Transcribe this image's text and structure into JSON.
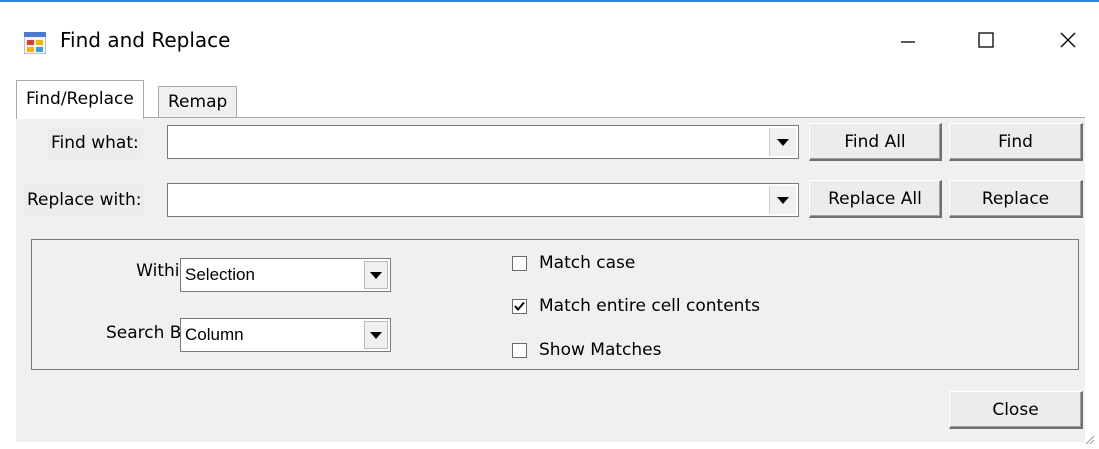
{
  "window": {
    "title": "Find and Replace",
    "icon": "form-app-icon",
    "controls": [
      "minimize-icon",
      "maximize-icon",
      "close-icon"
    ]
  },
  "tabs": [
    {
      "label": "Find/Replace",
      "active": true
    },
    {
      "label": "Remap",
      "active": false
    }
  ],
  "find": {
    "label": "Find what:",
    "value": "",
    "find_all_label": "Find All",
    "find_label": "Find"
  },
  "replace": {
    "label": "Replace with:",
    "value": "",
    "replace_all_label": "Replace All",
    "replace_label": "Replace"
  },
  "options": {
    "within_label": "Within:",
    "within_value": "Selection",
    "search_by_label": "Search By:",
    "search_by_value": "Column",
    "checkboxes": [
      {
        "label": "Match case",
        "checked": false
      },
      {
        "label": "Match entire cell contents",
        "checked": true
      },
      {
        "label": "Show Matches",
        "checked": false
      }
    ]
  },
  "footer": {
    "close_label": "Close"
  },
  "colors": {
    "title_accent": "#2e87d8",
    "panel_bg": "#f0f0f0"
  }
}
